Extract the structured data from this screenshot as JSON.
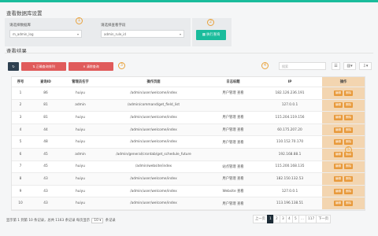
{
  "colors": {
    "accent": "#1abc9c",
    "danger": "#e05b5b",
    "warning": "#e89a3c",
    "dark": "#2f4050"
  },
  "config": {
    "title": "查看数据库设置",
    "db_label": "请选择数据库",
    "db_value": "m_admin_log",
    "table_label": "请选择查看字段",
    "table_value": "admin_rule_id",
    "submit_label": "执行查询"
  },
  "results": {
    "title": "查看结果",
    "btn_sort": "正确查询排列",
    "btn_clear": "清除查询",
    "search_placeholder": "搜索"
  },
  "badges": [
    "1",
    "2",
    "3",
    "4",
    "5"
  ],
  "table": {
    "headers": [
      "序号",
      "查询ID",
      "管理员名字",
      "操作页面",
      "日志标题",
      "IP",
      "操作"
    ],
    "op_labels": [
      "编辑",
      "删除"
    ],
    "rows": [
      [
        "1",
        "86",
        "huiyu",
        "/admin/user/welcome/index",
        "用户管理 查看",
        "182.126.236.191"
      ],
      [
        "2",
        "81",
        "admin",
        "/admin/command/get_field_list",
        "",
        "127.0.0.1"
      ],
      [
        "3",
        "81",
        "huiyu",
        "/admin/user/welcome/index",
        "用户管理 查看",
        "115.204.119.156"
      ],
      [
        "4",
        "44",
        "huiyu",
        "/admin/user/welcome/index",
        "用户管理 查看",
        "60.175.207.20"
      ],
      [
        "5",
        "48",
        "huiyu",
        "/admin/user/welcome/index",
        "用户管理 查看",
        "110.152.70.170"
      ],
      [
        "6",
        "45",
        "admin",
        "/admin/general/crontab/get_schedule_future",
        "",
        "192.168.88.1"
      ],
      [
        "7",
        "45",
        "huiyu",
        "/admin/website/index",
        "站点管理 查看",
        "115.200.168.135"
      ],
      [
        "8",
        "43",
        "huiyu",
        "/admin/user/welcome/index",
        "用户管理 查看",
        "182.150.132.53"
      ],
      [
        "9",
        "43",
        "huiyu",
        "/admin/user/welcome/index",
        "Website 查看",
        "127.0.0.1"
      ],
      [
        "10",
        "43",
        "huiyu",
        "/admin/user/welcome/index",
        "用户管理 查看",
        "113.196.138.51"
      ]
    ]
  },
  "footer": {
    "prefix": "显示第 1 到第 10 条记录，总共 1163 条记录 每页显示",
    "per_page": "10",
    "suffix": "条记录"
  },
  "pager": [
    "上一页",
    "1",
    "2",
    "3",
    "4",
    "5",
    "...",
    "117",
    "下一页"
  ]
}
